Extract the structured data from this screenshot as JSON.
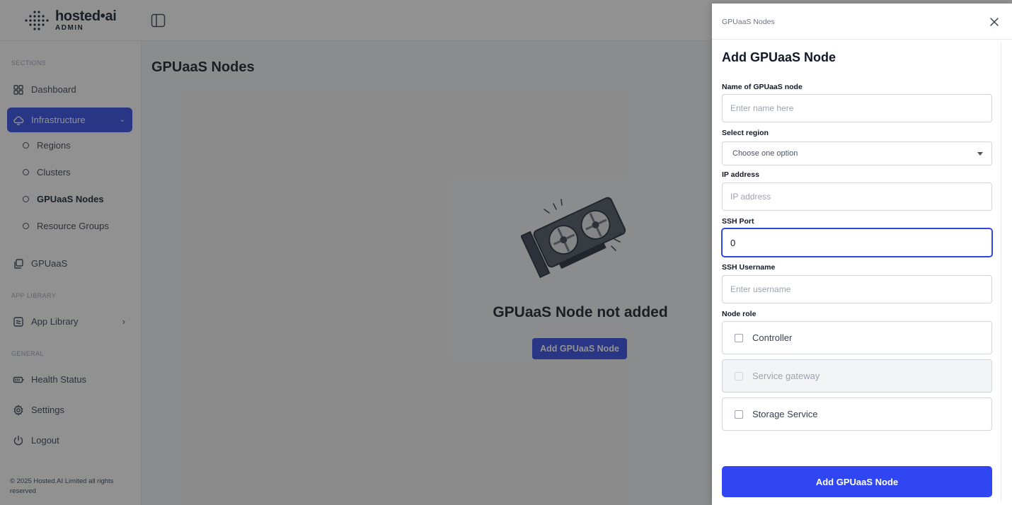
{
  "brand": {
    "name": "hosted•ai",
    "sub": "ADMIN"
  },
  "sidebar": {
    "section_labels": {
      "sections": "SECTIONS",
      "app_library": "APP LIBRARY",
      "general": "GENERAL"
    },
    "dashboard": "Dashboard",
    "infrastructure": "Infrastructure",
    "sub_items": [
      "Regions",
      "Clusters",
      "GPUaaS Nodes",
      "Resource Groups"
    ],
    "gpuaas": "GPUaaS",
    "app_library": "App Library",
    "health_status": "Health Status",
    "settings": "Settings",
    "logout": "Logout",
    "footer": "© 2025 Hosted.AI Limited all rights reserved"
  },
  "main": {
    "title": "GPUaaS Nodes",
    "empty_title": "GPUaaS Node not added",
    "empty_button": "Add GPUaaS Node"
  },
  "drawer": {
    "breadcrumb": "GPUaaS Nodes",
    "title": "Add GPUaaS Node",
    "name_label": "Name of GPUaaS node",
    "name_placeholder": "Enter name here",
    "region_label": "Select region",
    "region_value": "Choose one option",
    "ip_label": "IP address",
    "ip_placeholder": "IP address",
    "ssh_port_label": "SSH Port",
    "ssh_port_value": "0",
    "ssh_user_label": "SSH Username",
    "ssh_user_placeholder": "Enter username",
    "role_label": "Node role",
    "roles": [
      {
        "label": "Controller",
        "checked": false,
        "disabled": false
      },
      {
        "label": "Service gateway",
        "checked": false,
        "disabled": true
      },
      {
        "label": "Storage Service",
        "checked": false,
        "disabled": false
      }
    ],
    "submit": "Add GPUaaS Node"
  },
  "colors": {
    "accent": "#2f46e6",
    "overlay": "rgba(35,35,35,0.5)"
  }
}
